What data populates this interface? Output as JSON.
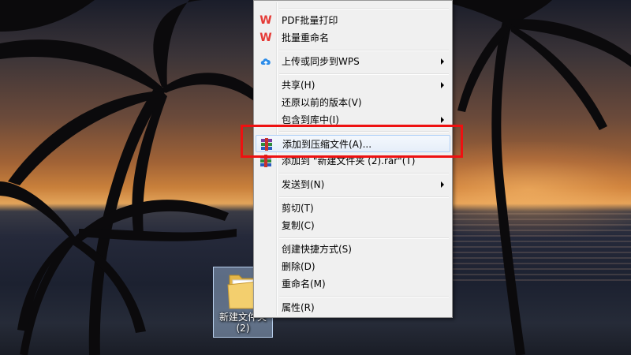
{
  "desktop": {
    "folder": {
      "name": "新建文件夹\n(2)"
    }
  },
  "context_menu": {
    "items": [
      {
        "label": "PDF批量打印",
        "icon": "wps-icon"
      },
      {
        "label": "批量重命名",
        "icon": "wps-icon"
      },
      {
        "label": "上传或同步到WPS",
        "icon": "cloud-upload-icon",
        "submenu": true
      },
      {
        "label": "共享(H)",
        "submenu": true
      },
      {
        "label": "还原以前的版本(V)"
      },
      {
        "label": "包含到库中(I)",
        "submenu": true
      },
      {
        "label": "添加到压缩文件(A)...",
        "icon": "winrar-icon",
        "highlighted": true
      },
      {
        "label": "添加到 \"新建文件夹 (2).rar\"(T)",
        "icon": "winrar-icon"
      },
      {
        "label": "发送到(N)",
        "submenu": true
      },
      {
        "label": "剪切(T)"
      },
      {
        "label": "复制(C)"
      },
      {
        "label": "创建快捷方式(S)"
      },
      {
        "label": "删除(D)"
      },
      {
        "label": "重命名(M)"
      },
      {
        "label": "属性(R)"
      }
    ]
  },
  "annotation": {
    "color": "#ee1111"
  }
}
